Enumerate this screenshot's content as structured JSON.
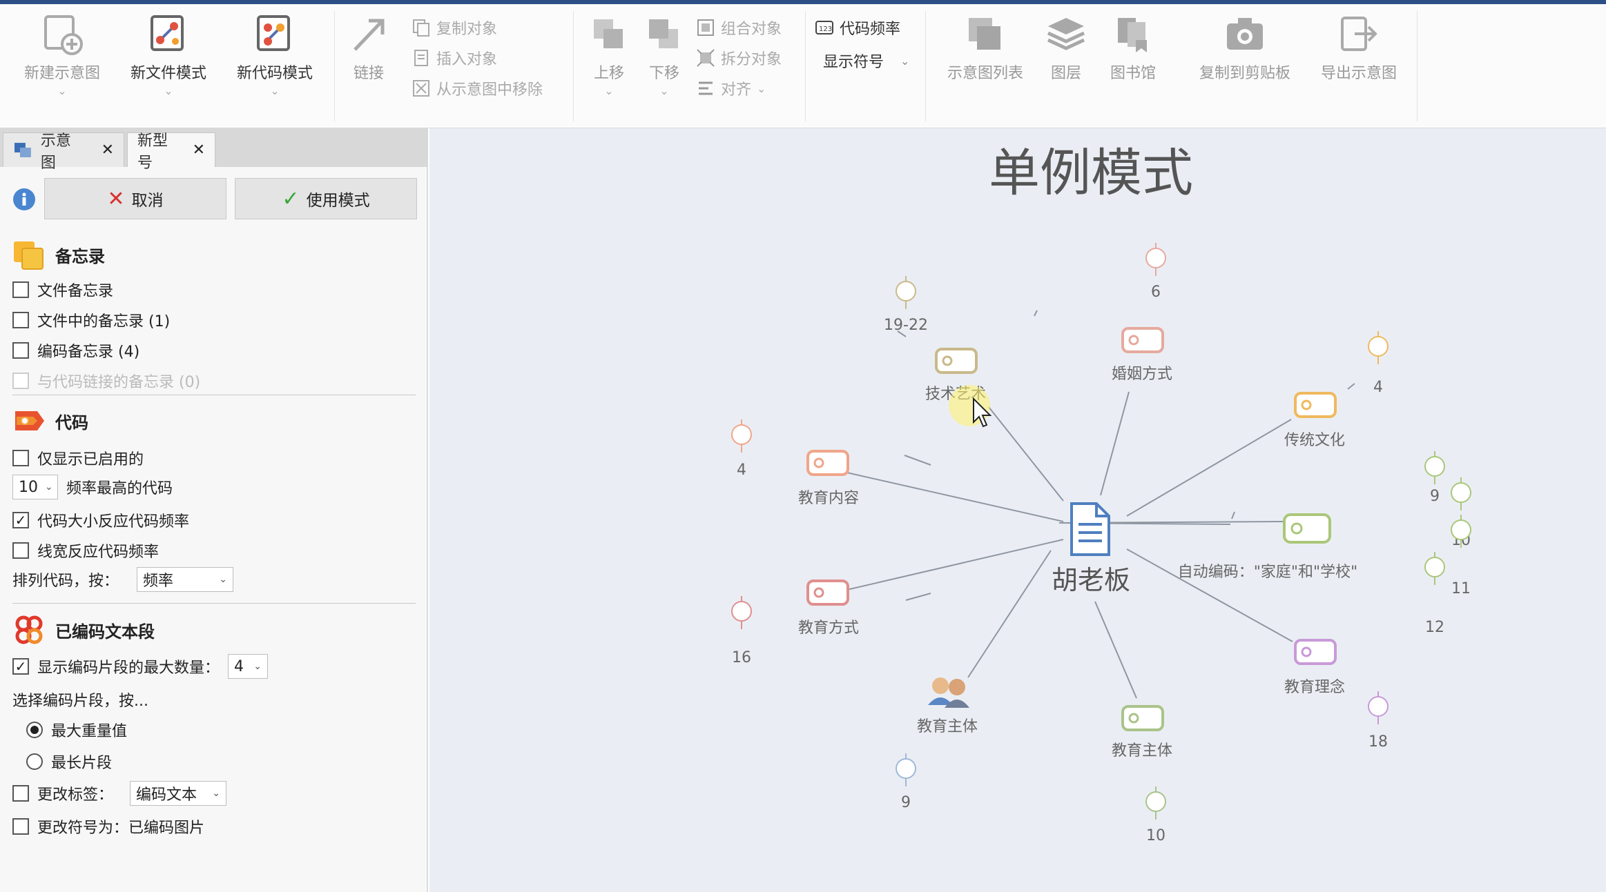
{
  "ribbon": {
    "new_diagram": "新建示意图",
    "new_doc_mode": "新文件模式",
    "new_code_mode": "新代码模式",
    "link": "链接",
    "copy_object": "复制对象",
    "insert_object": "插入对象",
    "remove_from_diagram": "从示意图中移除",
    "move_up": "上移",
    "move_down": "下移",
    "group_object": "组合对象",
    "split_object": "拆分对象",
    "align": "对齐",
    "code_frequency": "代码频率",
    "show_symbol": "显示符号",
    "diagram_list": "示意图列表",
    "layers": "图层",
    "library": "图书馆",
    "copy_clipboard": "复制到剪贴板",
    "export_diagram": "导出示意图"
  },
  "tabs": [
    {
      "label": "示意图"
    },
    {
      "label": "新型号"
    }
  ],
  "panel": {
    "cancel": "取消",
    "use_mode": "使用模式",
    "memo_title": "备忘录",
    "memo_items": [
      "文件备忘录",
      "文件中的备忘录 (1)",
      "编码备忘录 (4)",
      "与代码链接的备忘录 (0)"
    ],
    "code_title": "代码",
    "only_enabled": "仅显示已启用的",
    "top_count": "10",
    "top_codes_label": "频率最高的代码",
    "size_reflects": "代码大小反应代码频率",
    "width_reflects": "线宽反应代码频率",
    "sort_label": "排列代码，按：",
    "sort_value": "频率",
    "segments_title": "已编码文本段",
    "show_max": "显示编码片段的最大数量：",
    "max_value": "4",
    "select_by": "选择编码片段，按...",
    "radio_max_weight": "最大重量值",
    "radio_longest": "最长片段",
    "change_label": "更改标签：",
    "change_label_value": "编码文本",
    "change_symbol": "更改符号为：已编码图片"
  },
  "diagram": {
    "title": "单例模式",
    "center": "胡老板",
    "nodes": [
      {
        "label": "技术艺术",
        "count": "19-22",
        "color": "#c9b98a"
      },
      {
        "label": "婚姻方式",
        "count": "6",
        "color": "#e6a99e"
      },
      {
        "label": "传统文化",
        "count": "4",
        "color": "#f0b95f"
      },
      {
        "label": "教育内容",
        "count": "4",
        "color": "#f0a58a"
      },
      {
        "label": "自动编码：\"家庭\"和\"学校\"",
        "count": "9",
        "color": "#aac779"
      },
      {
        "label": "教育方式",
        "count": "16",
        "color": "#e08f8f"
      },
      {
        "label": "教育理念",
        "count": "18",
        "color": "#c89ad8"
      },
      {
        "label": "教育主体",
        "count": "9",
        "color": "#9fb8d8"
      },
      {
        "label": "教育主体",
        "count": "10",
        "color": "#aac38a"
      }
    ],
    "extra_counts": [
      "10",
      "11",
      "12"
    ]
  },
  "colors": {
    "accent": "#2d4f86",
    "canvas_bg": "#eaeef4",
    "check_green": "#3aa53a",
    "cancel_red": "#d9322f"
  }
}
